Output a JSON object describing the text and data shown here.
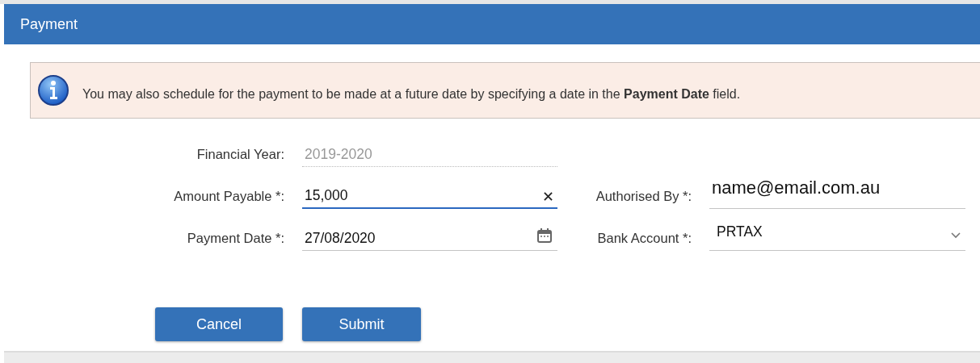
{
  "dialog": {
    "title": "Payment"
  },
  "info": {
    "text": "You may also schedule for the payment to be made at a future date by specifying a date in the **Payment Date** field."
  },
  "rows": [
    [
      {
        "label": "Financial Year:",
        "value": "2019-2020",
        "kind": "readonly",
        "focused": false
      }
    ],
    [
      {
        "label": "Amount Payable *:",
        "value": "15,000",
        "kind": "clearable",
        "focused": true
      },
      {
        "label": "Authorised By *:",
        "value": "name@email.com.au",
        "kind": "email",
        "focused": false
      }
    ],
    [
      {
        "label": "Payment Date *:",
        "value": "27/08/2020",
        "kind": "date",
        "focused": false
      },
      {
        "label": "Bank Account *:",
        "value": "PRTAX",
        "kind": "select",
        "focused": false
      }
    ]
  ],
  "buttons": [
    {
      "label": "Cancel"
    },
    {
      "label": "Submit"
    }
  ]
}
